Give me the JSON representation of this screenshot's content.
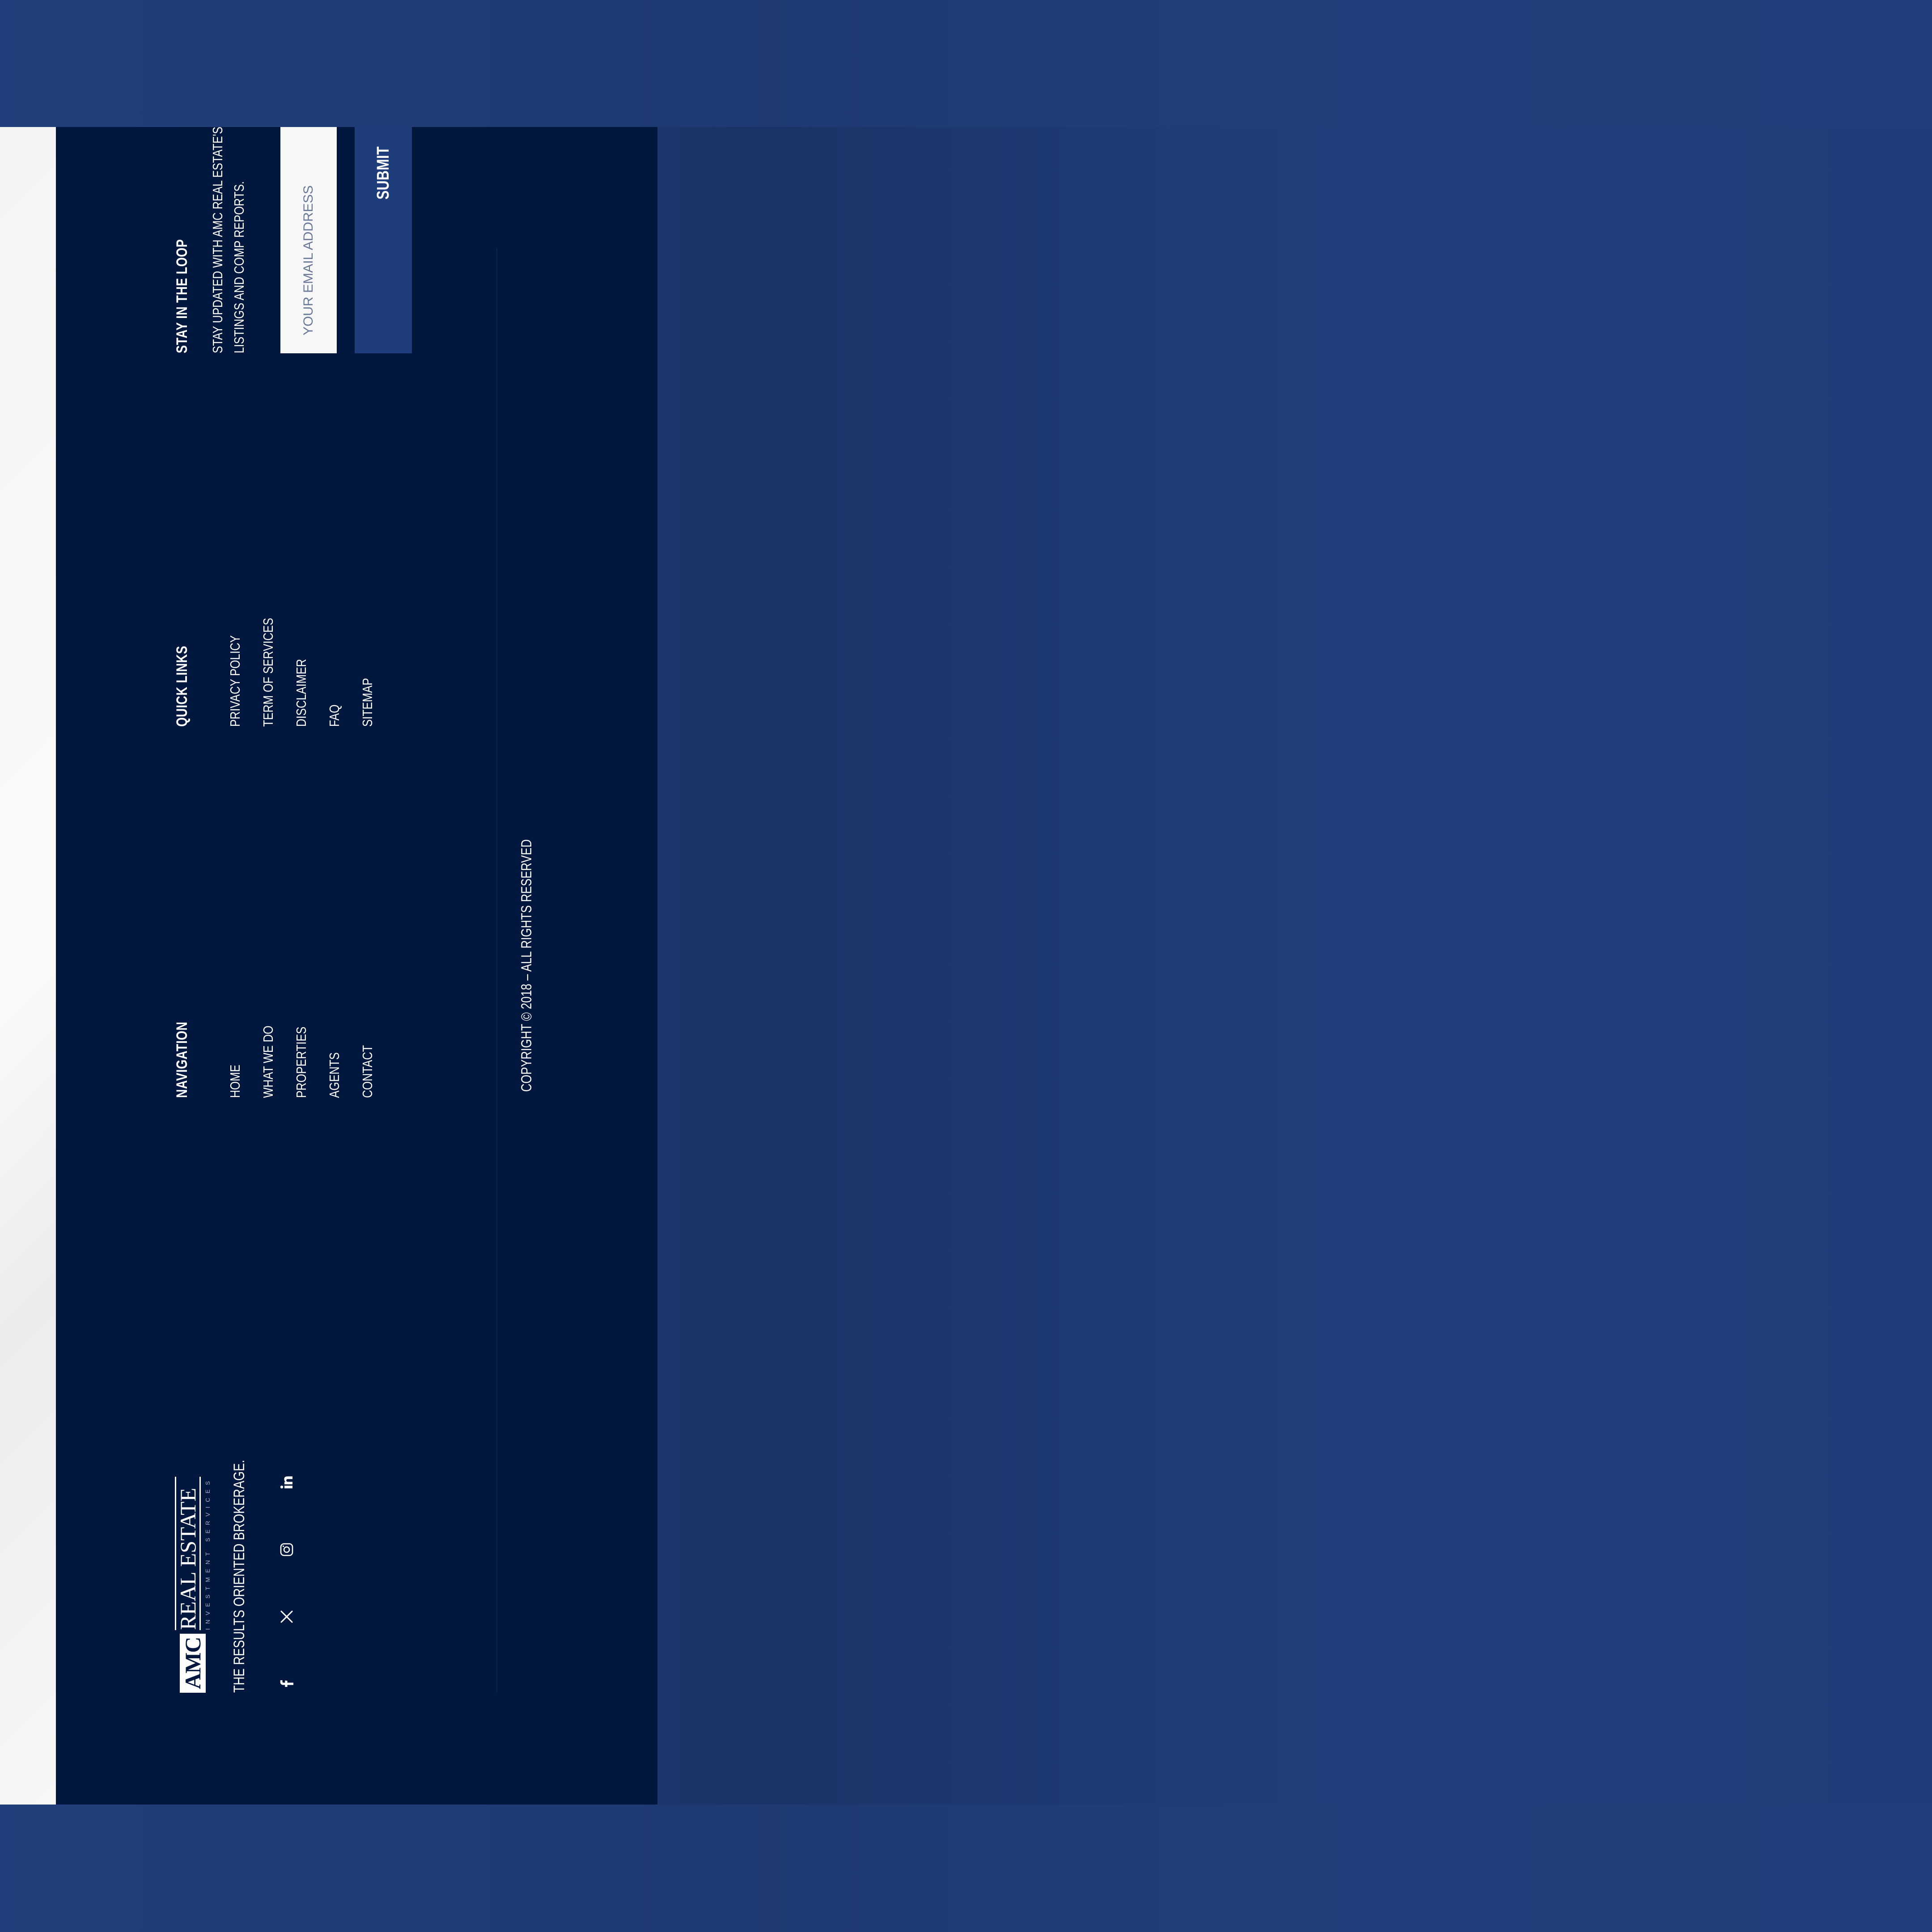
{
  "brand": {
    "logo_box": "AMC",
    "logo_main": "REAL ESTATE",
    "logo_sub": "INVESTMENT SERVICES",
    "tagline": "THE RESULTS ORIENTED BROKERAGE."
  },
  "socials": [
    {
      "icon": "facebook-icon"
    },
    {
      "icon": "x-twitter-icon"
    },
    {
      "icon": "instagram-icon"
    },
    {
      "icon": "linkedin-icon"
    }
  ],
  "navigation": {
    "heading": "NAVIGATION",
    "items": [
      "HOME",
      "WHAT WE DO",
      "PROPERTIES",
      "AGENTS",
      "CONTACT"
    ]
  },
  "quick_links": {
    "heading": "QUICK LINKS",
    "items": [
      "PRIVACY POLICY",
      "TERM OF SERVICES",
      "DISCLAIMER",
      "FAQ",
      "SITEMAP"
    ]
  },
  "newsletter": {
    "heading": "STAY IN THE LOOP",
    "text": "STAY UPDATED WITH AMC REAL ESTATE'S NEWSLETTERS, NEW LISTINGS AND COMP REPORTS.",
    "email_placeholder": "YOUR EMAIL ADDRESS",
    "email_value": "",
    "submit_label": "SUBMIT"
  },
  "copyright": "COPYRIGHT © 2018 – ALL RIGHTS RESERVED",
  "colors": {
    "background": "#1f3d7a",
    "footer": "#02173d",
    "button": "#1f3d7a",
    "input": "#f7f7f7"
  }
}
